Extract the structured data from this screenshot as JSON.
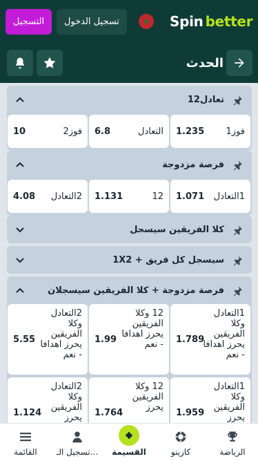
{
  "header": {
    "register_label": "التسجيل",
    "login_label": "تسجيل الدخول",
    "flag_symbol": "★",
    "logo_spin": "Spin",
    "logo_better": "better",
    "brand_color": "#b6e11f",
    "register_color": "#c21cd9"
  },
  "subheader": {
    "title": "الحدث",
    "back_icon": "arrow-right-icon",
    "favorite_icon": "star-icon",
    "notify_icon": "bell-icon"
  },
  "sections": [
    {
      "title": "1تعادل2",
      "expanded": true,
      "odds": [
        {
          "label": "فوز1",
          "value": "1.235"
        },
        {
          "label": "التعادل",
          "value": "6.8"
        },
        {
          "label": "فوز2",
          "value": "10"
        }
      ]
    },
    {
      "title": "فرصة مزدوجة",
      "expanded": true,
      "odds": [
        {
          "label": "1التعادل",
          "value": "1.071"
        },
        {
          "label": "12",
          "value": "1.131"
        },
        {
          "label": "2التعادل",
          "value": "4.08"
        }
      ]
    },
    {
      "title": "كلا الفريقين سيسجل",
      "expanded": false
    },
    {
      "title": "1X2 + سيسجل كل فريق",
      "expanded": false
    },
    {
      "title": "فرصة مزدوجة + كلا الفريقين سيسجلان",
      "expanded": true,
      "odds": [
        {
          "label": "1التعادل وكلا الفريقين يحرز اهدافا - نعم",
          "value": "1.789"
        },
        {
          "label": "12 وكلا الفريقين يحرز اهدافا - نعم",
          "value": "1.99"
        },
        {
          "label": "2التعادل وكلا الفريقين يحرز اهدافا - نعم",
          "value": "5.55"
        },
        {
          "label": "1التعادل وكلا الفريقين يحرز",
          "value": "1.959"
        },
        {
          "label": "12 وكلا الفريقين يحرز",
          "value": "1.764"
        },
        {
          "label": "2التعادل وكلا الفريقين يحرز",
          "value": "1.124"
        }
      ]
    }
  ],
  "bottom_nav": [
    {
      "label": "الرياضة",
      "icon": "trophy-icon"
    },
    {
      "label": "كازينو",
      "icon": "casino-chip-icon"
    },
    {
      "label": "القسيمة",
      "icon": "ticket-icon",
      "active": true
    },
    {
      "label": "تسجيل الـ...",
      "icon": "user-icon"
    },
    {
      "label": "القائمة",
      "icon": "menu-icon"
    }
  ]
}
